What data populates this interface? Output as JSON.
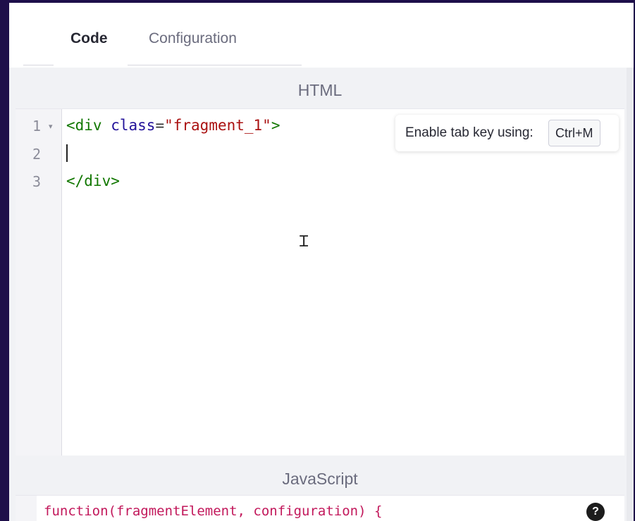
{
  "tabs": {
    "code": "Code",
    "configuration": "Configuration"
  },
  "html_section": {
    "title": "HTML",
    "line_numbers": [
      "1",
      "2",
      "3"
    ],
    "fold_marker": "▾",
    "line1": {
      "open_tag": "<div",
      "attr_name": "class",
      "equals": "=",
      "attr_value": "\"fragment_1\"",
      "close": ">"
    },
    "line3": "</div>",
    "hint_text": "Enable tab key using:",
    "hint_key": "Ctrl+M"
  },
  "js_section": {
    "title": "JavaScript",
    "code_line": "function(fragmentElement, configuration) {",
    "help_label": "?"
  },
  "colors": {
    "tag": "#117700",
    "attribute": "#221199",
    "string": "#aa1111",
    "js_text": "#c2185b",
    "frame": "#1e0f4a"
  }
}
